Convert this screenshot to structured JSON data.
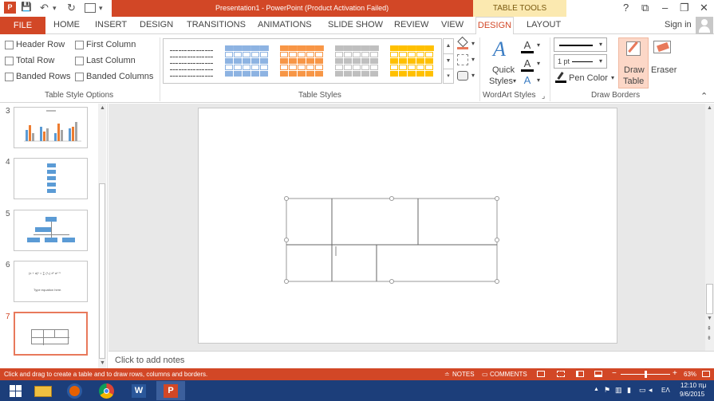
{
  "window": {
    "title": "Presentation1 - PowerPoint (Product Activation Failed)",
    "contextual_tab_group": "TABLE TOOLS",
    "help": "?",
    "restore": "⧉",
    "minimize": "–",
    "maximize": "❐",
    "close": "✕"
  },
  "quick_access": {
    "save": "💾",
    "undo": "↶",
    "redo": "↻",
    "more": "▾"
  },
  "tabs": {
    "file": "FILE",
    "items": [
      "HOME",
      "INSERT",
      "DESIGN",
      "TRANSITIONS",
      "ANIMATIONS",
      "SLIDE SHOW",
      "REVIEW",
      "VIEW"
    ],
    "design_active": "DESIGN",
    "layout": "LAYOUT",
    "sign_in": "Sign in"
  },
  "ribbon": {
    "table_style_options": {
      "group_label": "Table Style Options",
      "header_row": "Header Row",
      "first_column": "First Column",
      "total_row": "Total Row",
      "last_column": "Last Column",
      "banded_rows": "Banded Rows",
      "banded_columns": "Banded Columns"
    },
    "table_styles": {
      "group_label": "Table Styles",
      "thumb_colors": [
        "#ffffff",
        "#8db3e2",
        "#f79646",
        "#bfbfbf",
        "#ffc000"
      ]
    },
    "wordart": {
      "group_label": "WordArt Styles",
      "quick_styles_line1": "Quick",
      "quick_styles_line2": "Styles",
      "quick_styles_arrow": "▾",
      "dialog_launcher": "⌟"
    },
    "draw_borders": {
      "group_label": "Draw Borders",
      "pen_weight": "1 pt",
      "pen_color": "Pen Color",
      "pen_color_arrow": "▾",
      "draw_table_line1": "Draw",
      "draw_table_line2": "Table",
      "eraser": "Eraser",
      "collapse": "⌃"
    }
  },
  "slides": {
    "numbers": [
      "3",
      "4",
      "5",
      "6",
      "7"
    ],
    "thumb6_formula": "(x + a)ⁿ = ∑ (ⁿₖ) xᵏ aⁿ⁻ᵏ",
    "thumb6_caption": "Type equation here."
  },
  "notes": {
    "placeholder": "Click to add notes"
  },
  "status": {
    "hint": "Click and drag to create a table and to draw rows, columns and borders.",
    "notes": "NOTES",
    "comments": "COMMENTS",
    "zoom_minus": "−",
    "zoom_plus": "+",
    "zoom_pct": "63%",
    "zoom_level_pct": 50
  },
  "taskbar": {
    "tray_lang": "ΕΛ",
    "time": "12:10 πμ",
    "date": "9/6/2015",
    "tray_caret": "▲"
  }
}
